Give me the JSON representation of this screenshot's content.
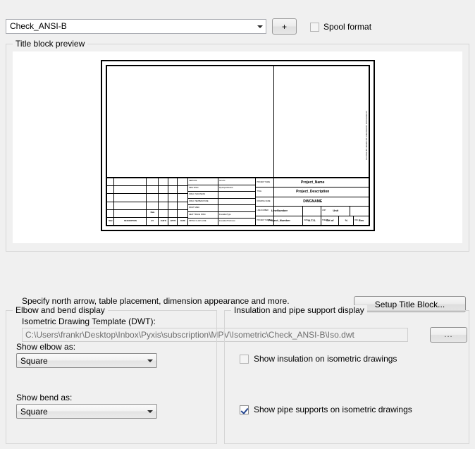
{
  "top": {
    "template_combo": {
      "value": "Check_ANSI-B",
      "arrow_icon": "chevron-down-icon"
    },
    "add_button_label": "+",
    "spool_format": {
      "label": "Spool format",
      "checked": false,
      "enabled": false
    }
  },
  "preview_group": {
    "title": "Title block preview",
    "titleblock": {
      "revision_columns": [
        "REV.",
        "DESCRIPTION",
        "BY",
        "CHK'D",
        "APP'D",
        "DATE"
      ],
      "revision_rows": 6,
      "date_header": "Date",
      "middle_rows": [
        {
          "label": "SERVICE",
          "value": "Service"
        },
        {
          "label": "PIPE SPEC",
          "value": "PipeSpecification"
        },
        {
          "label": "INSUL THICKNESS",
          "value": ""
        },
        {
          "label": "INSUL TEMPERATURE",
          "value": ""
        },
        {
          "label": "PAINT SPEC",
          "value": ""
        },
        {
          "label": "HEAT TRACE SPEC",
          "value": "InsulationType"
        },
        {
          "label": "PIPING CLASS LINE",
          "value": "InsulationThickness"
        }
      ],
      "right_rows": [
        {
          "tag": "PROJECT NAME",
          "value": "Project_Name"
        },
        {
          "tag": "TITLE",
          "value": "Project_Description"
        },
        {
          "tag": "DRAWING NAME",
          "value": "DWGNAME"
        }
      ],
      "line_row": [
        {
          "tag": "LINE NUMBER",
          "value": "LineNumber"
        },
        {
          "tag": "UNIT",
          "value": "Unit"
        }
      ],
      "footer_row": [
        {
          "tag": "PROJECT NUMBER",
          "value": "Project_Number"
        },
        {
          "tag": "DWG",
          "value": "N.T.S."
        },
        {
          "tag": "SHEET",
          "value": "SH  of"
        },
        {
          "tag": "SC",
          "value": "%"
        },
        {
          "tag": "REV",
          "value": "Rev"
        }
      ],
      "vertical_text": "PLOTTED BY: DRAWN BY: CHECKED BY: APPROVED BY:"
    },
    "specify_text": "Specify north arrow, table placement, dimension appearance and more.",
    "setup_button_label": "Setup Title Block...",
    "dwt_label": "Isometric Drawing Template (DWT):",
    "dwt_path": "C:\\Users\\frankr\\Desktop\\Inbox\\Pyxis\\subscription\\MPV\\Isometric\\Check_ANSI-B\\Iso.dwt",
    "browse_button_label": "..."
  },
  "elbow_group": {
    "title": "Elbow and bend display",
    "elbow_label": "Show elbow as:",
    "elbow_value": "Square",
    "bend_label": "Show bend as:",
    "bend_value": "Square"
  },
  "insulation_group": {
    "title": "Insulation and pipe support display",
    "insulation": {
      "label": "Show insulation on isometric drawings",
      "checked": false,
      "enabled": false
    },
    "pipe_supports": {
      "label": "Show pipe supports on isometric drawings",
      "checked": true,
      "enabled": true
    }
  },
  "colors": {
    "window_bg": "#f0f0f0",
    "panel_bg": "#ffffff",
    "groupbox_border": "#d5d5d5",
    "check_accent": "#21438e",
    "disabled_text": "#6d6d6d"
  }
}
